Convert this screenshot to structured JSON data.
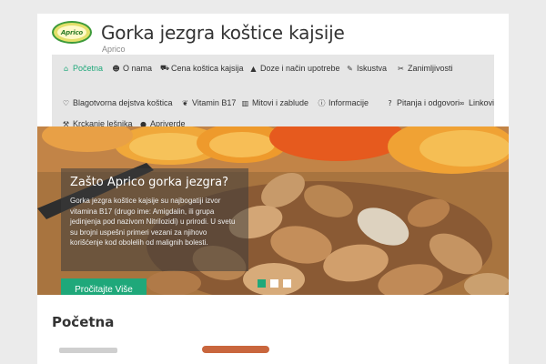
{
  "site": {
    "logo_text": "Aprico",
    "title": "Gorka jezgra koštice kajsije",
    "tagline": "Aprico"
  },
  "nav": [
    {
      "label": "Početna",
      "icon": "home-icon"
    },
    {
      "label": "O nama",
      "icon": "users-icon"
    },
    {
      "label": "Cena koštica kajsija",
      "icon": "cart-icon"
    },
    {
      "label": "Doze i način upotrebe",
      "icon": "flask-icon"
    },
    {
      "label": "Iskustva",
      "icon": "pencil-icon"
    },
    {
      "label": "Zanimljivosti",
      "icon": "tools-icon"
    },
    {
      "label": "Blagotvorna dejstva koštica",
      "icon": "heart-icon"
    },
    {
      "label": "Vitamin B17",
      "icon": "leaf-icon"
    },
    {
      "label": "Mitovi i zablude",
      "icon": "book-icon"
    },
    {
      "label": "Informacije",
      "icon": "info-icon"
    },
    {
      "label": "Pitanja i odgovori",
      "icon": "question-icon"
    },
    {
      "label": "Linkovi",
      "icon": "link-icon"
    },
    {
      "label": "Krckanje lešnika",
      "icon": "hammer-icon"
    },
    {
      "label": "Apriverde",
      "icon": "drop-icon"
    }
  ],
  "slider": {
    "title": "Zašto Aprico gorka jezgra?",
    "text": "Gorka jezgra koštice kajsije su najbogatiji izvor vitamina B17 (drugo ime: Amigdalin, ili grupa jedinjenja pod nazivom Nitrilozidi) u prirodi. U svetu su brojni uspešni primeri vezani za njihovo korišćenje kod obolelih od malignih bolesti.",
    "button": "Pročitajte Više",
    "active_slide": 1,
    "slide_count": 3
  },
  "content": {
    "heading": "Početna"
  },
  "colors": {
    "accent": "#1fa87a",
    "page_bg": "#ebebeb",
    "nav_bg": "#e6e6e6"
  }
}
